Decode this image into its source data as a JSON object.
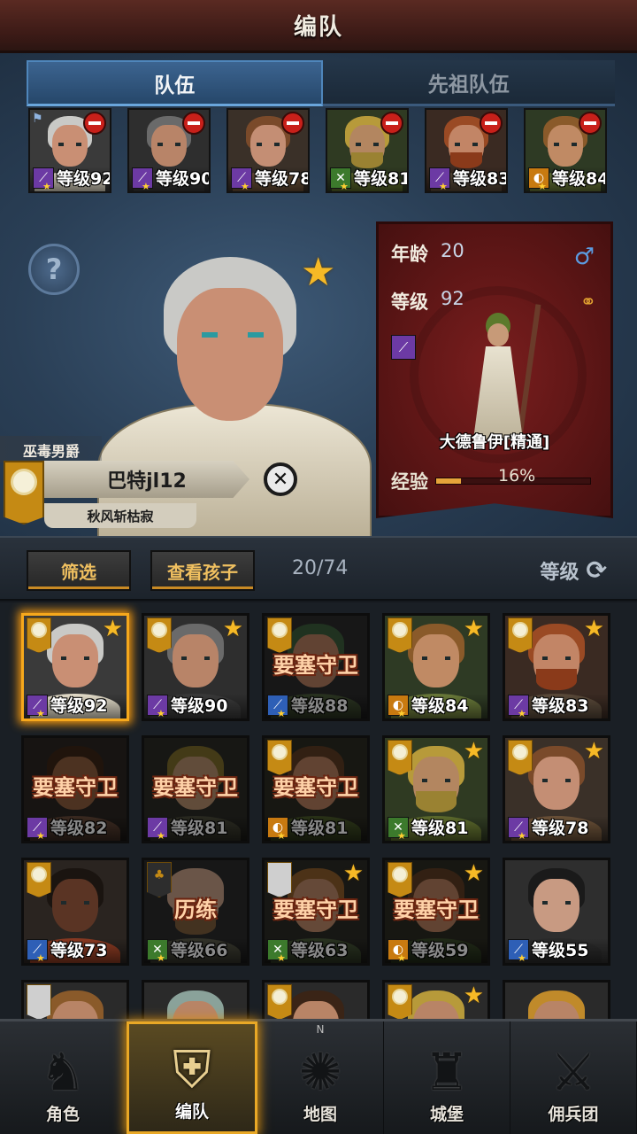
{
  "header": {
    "title": "编队"
  },
  "tabs": [
    {
      "label": "队伍",
      "active": true
    },
    {
      "label": "先祖队伍",
      "active": false
    }
  ],
  "team": [
    {
      "level": "等级92",
      "class_icon": "staff-icon",
      "class_color": "#6c3aa4",
      "hair": "#c9c9c6",
      "skin": "#c98f74",
      "beard": "",
      "body": "#e6dfcc",
      "bg": "#3a3a3a",
      "leader_flag": true
    },
    {
      "level": "等级90",
      "class_icon": "staff-icon",
      "class_color": "#6c3aa4",
      "hair": "#6a6a6a",
      "skin": "#b88468",
      "beard": "",
      "body": "#3a3a3a",
      "bg": "#2e2e2e"
    },
    {
      "level": "等级78",
      "class_icon": "staff-icon",
      "class_color": "#6c3aa4",
      "hair": "#7a4a2a",
      "skin": "#c48e74",
      "beard": "",
      "body": "#6b5138",
      "bg": "#3a3028"
    },
    {
      "level": "等级81",
      "class_icon": "bow-icon",
      "class_color": "#3c7a2c",
      "hair": "#b79a3a",
      "skin": "#b38660",
      "beard": "#9a8232",
      "body": "#5c6a2c",
      "bg": "#2f3a22"
    },
    {
      "level": "等级83",
      "class_icon": "staff-icon",
      "class_color": "#6c3aa4",
      "hair": "#9a4a24",
      "skin": "#c28566",
      "beard": "#8a3a1a",
      "body": "#5a4a3a",
      "bg": "#3a2a22"
    },
    {
      "level": "等级84",
      "class_icon": "shield-icon",
      "class_color": "#c87a10",
      "hair": "#8a5a2a",
      "skin": "#c08a64",
      "beard": "",
      "body": "#6a7a3a",
      "bg": "#2e3a24"
    }
  ],
  "hero": {
    "title": "巫毒男爵",
    "name": "巴特jl12",
    "subtitle": "秋风斩枯寂",
    "age_label": "年龄",
    "age": "20",
    "level_label": "等级",
    "level": "92",
    "class_name": "大德鲁伊[精通]",
    "exp_label": "经验",
    "exp_text": "16%",
    "exp_fraction": 0.16,
    "gender_icon": "male-icon",
    "star": true
  },
  "filter": {
    "filter_label": "筛选",
    "children_label": "查看孩子",
    "count": "20/74",
    "sort_label": "等级"
  },
  "roster": [
    {
      "level": "等级92",
      "status": "",
      "star": true,
      "banner": "sun",
      "class_color": "#6c3aa4",
      "class_icon": "staff-icon",
      "hair": "#c9c9c6",
      "skin": "#c98f74",
      "beard": "",
      "body": "#e6dfcc",
      "bg": "#3a3a3a",
      "selected": true
    },
    {
      "level": "等级90",
      "status": "",
      "star": true,
      "banner": "sun",
      "class_color": "#6c3aa4",
      "class_icon": "staff-icon",
      "hair": "#6a6a6a",
      "skin": "#b88468",
      "beard": "",
      "body": "#3a3a3a",
      "bg": "#2e2e2e"
    },
    {
      "level": "等级88",
      "status": "要塞守卫",
      "star": false,
      "banner": "sun",
      "class_color": "#2e5fb6",
      "class_icon": "sword-icon",
      "hair": "#3a5a3a",
      "skin": "#b07a5c",
      "beard": "",
      "body": "#4a5a3a",
      "bg": "#2a2a2a"
    },
    {
      "level": "等级84",
      "status": "",
      "star": true,
      "banner": "sun",
      "class_color": "#c87a10",
      "class_icon": "shield-icon",
      "hair": "#8a5a2a",
      "skin": "#c08a64",
      "beard": "",
      "body": "#6a7a3a",
      "bg": "#2e3a24"
    },
    {
      "level": "等级83",
      "status": "",
      "star": true,
      "banner": "sun",
      "class_color": "#6c3aa4",
      "class_icon": "staff-icon",
      "hair": "#9a4a24",
      "skin": "#c28566",
      "beard": "#8a3a1a",
      "body": "#5a4a3a",
      "bg": "#3a2a22"
    },
    {
      "level": "等级82",
      "status": "要塞守卫",
      "star": false,
      "banner": "",
      "class_color": "#6c3aa4",
      "class_icon": "staff-icon",
      "hair": "#3a2416",
      "skin": "#8a5a3c",
      "beard": "",
      "body": "#6a4a3a",
      "bg": "#2a2420"
    },
    {
      "level": "等级81",
      "status": "要塞守卫",
      "star": false,
      "banner": "",
      "class_color": "#6c3aa4",
      "class_icon": "staff-icon",
      "hair": "#7a6a2a",
      "skin": "#b08a6a",
      "beard": "",
      "body": "#4a4a3a",
      "bg": "#2a2a24"
    },
    {
      "level": "等级81",
      "status": "要塞守卫",
      "star": false,
      "banner": "sun",
      "class_color": "#c87a10",
      "class_icon": "shield-icon",
      "hair": "#5a3a22",
      "skin": "#b07a5a",
      "beard": "",
      "body": "#4a5a2a",
      "bg": "#2a2a20"
    },
    {
      "level": "等级81",
      "status": "",
      "star": true,
      "banner": "sun",
      "class_color": "#3c7a2c",
      "class_icon": "bow-icon",
      "hair": "#b79a3a",
      "skin": "#b38660",
      "beard": "#9a8232",
      "body": "#5c6a2c",
      "bg": "#2f3a22"
    },
    {
      "level": "等级78",
      "status": "",
      "star": true,
      "banner": "sun",
      "class_color": "#6c3aa4",
      "class_icon": "staff-icon",
      "hair": "#7a4a2a",
      "skin": "#c48e74",
      "beard": "",
      "body": "#6b5138",
      "bg": "#3a3028"
    },
    {
      "level": "等级73",
      "status": "",
      "star": false,
      "banner": "sun",
      "class_color": "#2e5fb6",
      "class_icon": "sword-icon",
      "hair": "#1a1410",
      "skin": "#5a3424",
      "beard": "",
      "body": "#8a3a22",
      "bg": "#2a2420"
    },
    {
      "level": "等级66",
      "status": "历练",
      "star": false,
      "banner": "tree",
      "class_color": "#3c7a2c",
      "class_icon": "bow-icon",
      "hair": "#c09a82",
      "skin": "#c09a82",
      "beard": "#7a5a3a",
      "body": "#5a5a4a",
      "bg": "#2a2a2a"
    },
    {
      "level": "等级63",
      "status": "要塞守卫",
      "star": true,
      "banner": "light",
      "class_color": "#3c7a2c",
      "class_icon": "bow-icon",
      "hair": "#8a5a2a",
      "skin": "#b88466",
      "beard": "",
      "body": "#4a5a3a",
      "bg": "#2a2a24"
    },
    {
      "level": "等级59",
      "status": "要塞守卫",
      "star": true,
      "banner": "sun",
      "class_color": "#c87a10",
      "class_icon": "shield-icon",
      "hair": "#5a3a22",
      "skin": "#b07a5a",
      "beard": "",
      "body": "#3a4a2a",
      "bg": "#2a2a20"
    },
    {
      "level": "等级55",
      "status": "",
      "star": false,
      "banner": "",
      "class_color": "#2e5fb6",
      "class_icon": "sword-icon",
      "hair": "#1a1a1a",
      "skin": "#c89a82",
      "beard": "",
      "body": "#2a2a2a",
      "bg": "#2e2e2e"
    },
    {
      "level": "",
      "status": "",
      "star": false,
      "banner": "light",
      "class_color": "",
      "class_icon": "",
      "hair": "#8a5a2a",
      "skin": "#b88466",
      "beard": "",
      "body": "#4a4a3a",
      "bg": "#2a2a2a"
    },
    {
      "level": "",
      "status": "",
      "star": false,
      "banner": "",
      "class_color": "",
      "class_icon": "",
      "hair": "#8aa29a",
      "skin": "#b88466",
      "beard": "",
      "body": "#4a4a3a",
      "bg": "#2a2a2a"
    },
    {
      "level": "",
      "status": "",
      "star": false,
      "banner": "sun",
      "class_color": "",
      "class_icon": "",
      "hair": "#3a2416",
      "skin": "#b88466",
      "beard": "",
      "body": "#4a4a3a",
      "bg": "#2a2a2a"
    },
    {
      "level": "",
      "status": "",
      "star": true,
      "banner": "sun",
      "class_color": "",
      "class_icon": "",
      "hair": "#b79a3a",
      "skin": "#b88466",
      "beard": "",
      "body": "#4a4a3a",
      "bg": "#2a2a2a"
    },
    {
      "level": "",
      "status": "",
      "star": false,
      "banner": "",
      "class_color": "",
      "class_icon": "",
      "hair": "#c08a2a",
      "skin": "#b88466",
      "beard": "",
      "body": "#4a4a3a",
      "bg": "#2a2a2a"
    }
  ],
  "nav": [
    {
      "label": "角色",
      "icon": "knight-icon",
      "active": false
    },
    {
      "label": "编队",
      "icon": "helmet-icon",
      "active": true
    },
    {
      "label": "地图",
      "icon": "compass-map-icon",
      "active": false
    },
    {
      "label": "城堡",
      "icon": "castle-icon",
      "active": false
    },
    {
      "label": "佣兵团",
      "icon": "mercenary-icon",
      "active": false
    }
  ],
  "colors": {
    "accent": "#f6a81c",
    "star": "#f6b926",
    "remove": "#c8201a"
  }
}
